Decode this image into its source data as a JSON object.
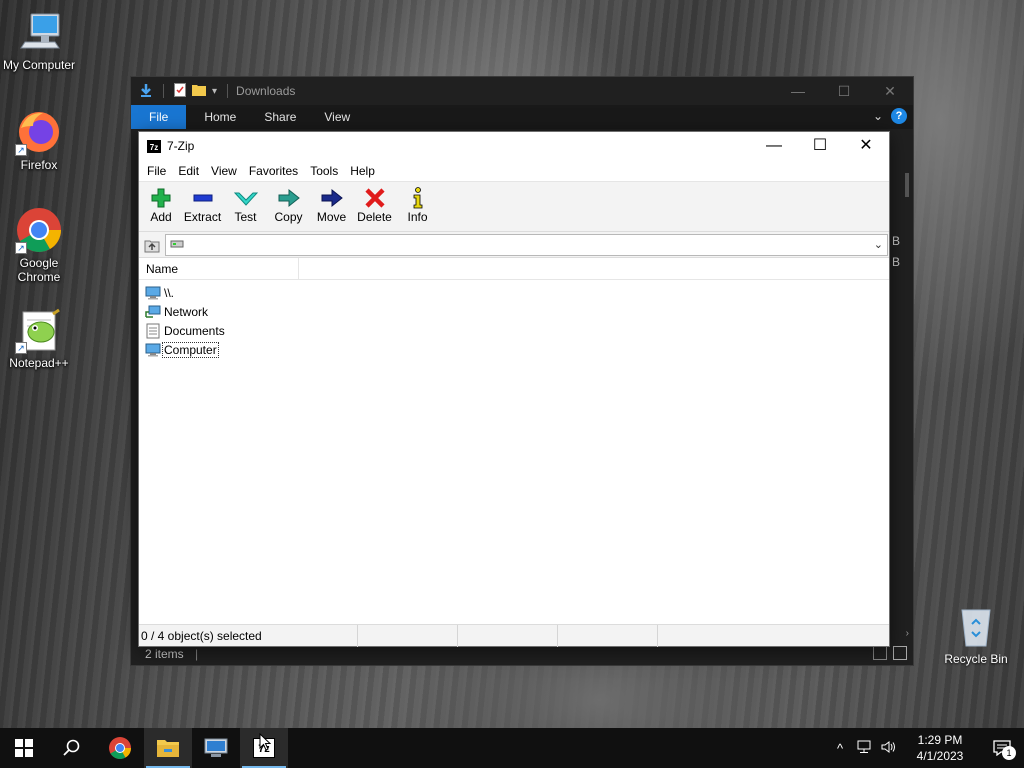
{
  "desktop": {
    "icons": [
      {
        "label": "My Computer"
      },
      {
        "label": "Firefox"
      },
      {
        "label": "Google Chrome"
      },
      {
        "label": "Notepad++"
      }
    ],
    "recycle_bin": "Recycle Bin"
  },
  "explorer": {
    "title": "Downloads",
    "tabs": [
      "File",
      "Home",
      "Share",
      "View"
    ],
    "status_items": "2 items",
    "side_letters": [
      "B",
      "B"
    ]
  },
  "zip": {
    "title": "7-Zip",
    "menu": [
      "File",
      "Edit",
      "View",
      "Favorites",
      "Tools",
      "Help"
    ],
    "toolbar": [
      "Add",
      "Extract",
      "Test",
      "Copy",
      "Move",
      "Delete",
      "Info"
    ],
    "address_value": "",
    "column_name": "Name",
    "items": [
      {
        "name": "\\\\.",
        "icon": "computer-icon"
      },
      {
        "name": "Network",
        "icon": "network-icon"
      },
      {
        "name": "Documents",
        "icon": "documents-icon"
      },
      {
        "name": "Computer",
        "icon": "computer-icon"
      }
    ],
    "status_selected": "0 / 4 object(s) selected"
  },
  "taskbar": {
    "time": "1:29 PM",
    "date": "4/1/2023",
    "notification_count": "1"
  },
  "colors": {
    "accent": "#1976d2",
    "taskbar": "#101010",
    "add_green": "#22b14c",
    "delete_red": "#e01b1b",
    "move_navy": "#1a2a8a"
  }
}
